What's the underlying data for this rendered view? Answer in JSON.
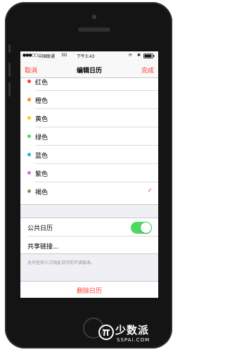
{
  "status_bar": {
    "signal": "●●●○○",
    "carrier": "中国联通",
    "network": "3G",
    "time": "下午3:43"
  },
  "nav": {
    "cancel_label": "取消",
    "title": "编辑日历",
    "done_label": "完成"
  },
  "colors": [
    {
      "label": "红色",
      "color": "#ff3b30",
      "selected": false
    },
    {
      "label": "橙色",
      "color": "#ff9500",
      "selected": false
    },
    {
      "label": "黄色",
      "color": "#ffcc00",
      "selected": false
    },
    {
      "label": "绿色",
      "color": "#4cd964",
      "selected": false
    },
    {
      "label": "蓝色",
      "color": "#34aadc",
      "selected": false
    },
    {
      "label": "紫色",
      "color": "#cc73e1",
      "selected": false
    },
    {
      "label": "褐色",
      "color": "#a2845e",
      "selected": true
    }
  ],
  "checkmark": "✓",
  "public_calendar": {
    "label": "公共日历",
    "enabled": true,
    "share_link_label": "共享链接..."
  },
  "footnote": "允许任何人订阅此日历的只读版本。",
  "delete_label": "删除日历",
  "watermark": {
    "text": "少数派",
    "sub": "SSPAI.COM"
  },
  "accent_color": "#ff3b30",
  "toggle_on_color": "#4cd964"
}
